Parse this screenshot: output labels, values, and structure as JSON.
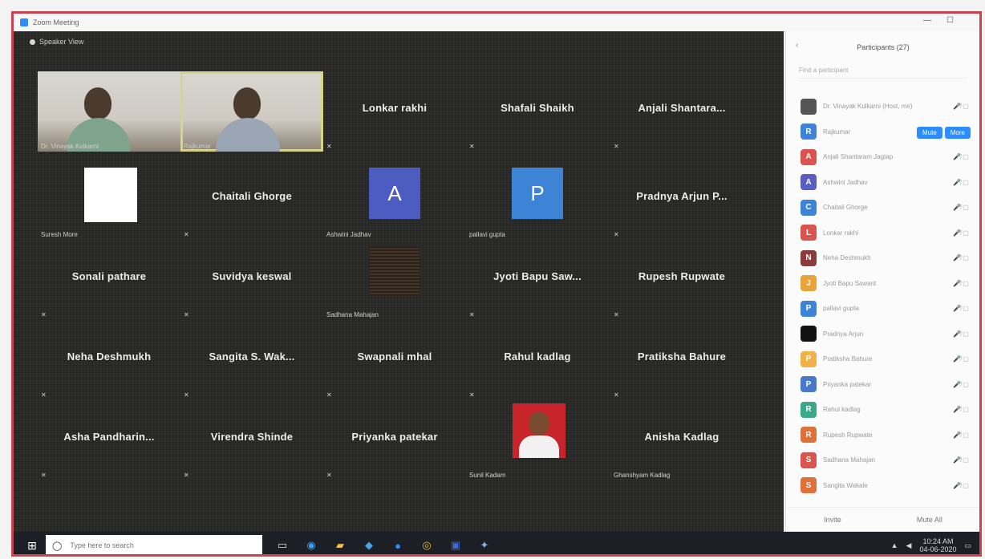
{
  "window": {
    "title": "Zoom Meeting",
    "minimize": "—",
    "maximize": "☐"
  },
  "gallery": {
    "view_label": "Speaker View",
    "tiles": [
      {
        "name": "",
        "caption": "Dr. Vinayak Kulkarni",
        "kind": "video"
      },
      {
        "name": "",
        "caption": "Rajkumar",
        "kind": "video-active"
      },
      {
        "name": "Lonkar rakhi",
        "caption": "",
        "kind": "name"
      },
      {
        "name": "Shafali Shaikh",
        "caption": "",
        "kind": "name"
      },
      {
        "name": "Anjali Shantara...",
        "caption": "",
        "kind": "name"
      },
      {
        "name": "",
        "caption": "Suresh More",
        "kind": "blank"
      },
      {
        "name": "Chaitali Ghorge",
        "caption": "",
        "kind": "name"
      },
      {
        "name": "",
        "caption": "Ashwini Jadhav",
        "kind": "avatar",
        "letter": "A",
        "color": "#4d5cc0"
      },
      {
        "name": "",
        "caption": "pallavi gupta",
        "kind": "avatar",
        "letter": "P",
        "color": "#3e84d6"
      },
      {
        "name": "Pradnya Arjun P...",
        "caption": "",
        "kind": "name"
      },
      {
        "name": "Sonali pathare",
        "caption": "",
        "kind": "name"
      },
      {
        "name": "Suvidya keswal",
        "caption": "",
        "kind": "name"
      },
      {
        "name": "",
        "caption": "Sadhana Mahajan",
        "kind": "dark"
      },
      {
        "name": "Jyoti Bapu Saw...",
        "caption": "",
        "kind": "name"
      },
      {
        "name": "Rupesh Rupwate",
        "caption": "",
        "kind": "name"
      },
      {
        "name": "Neha Deshmukh",
        "caption": "",
        "kind": "name"
      },
      {
        "name": "Sangita S. Wak...",
        "caption": "",
        "kind": "name"
      },
      {
        "name": "Swapnali mhal",
        "caption": "",
        "kind": "name"
      },
      {
        "name": "Rahul kadlag",
        "caption": "",
        "kind": "name"
      },
      {
        "name": "Pratiksha Bahure",
        "caption": "",
        "kind": "name"
      },
      {
        "name": "Asha Pandharin...",
        "caption": "",
        "kind": "name"
      },
      {
        "name": "Virendra Shinde",
        "caption": "",
        "kind": "name"
      },
      {
        "name": "Priyanka patekar",
        "caption": "",
        "kind": "name"
      },
      {
        "name": "",
        "caption": "Sunil Kadam",
        "kind": "photo"
      },
      {
        "name": "Anisha Kadlag",
        "caption": "Ghanshyam Kadlag",
        "kind": "name"
      }
    ]
  },
  "panel": {
    "title": "Participants (27)",
    "search_placeholder": "Find a participant",
    "rows": [
      {
        "text": "Dr. Vinayak Kulkarni (Host, me)",
        "color": "#555555",
        "letter": "",
        "buttons": []
      },
      {
        "text": "Rajkumar",
        "color": "#3e84d6",
        "letter": "R",
        "buttons": [
          "Mute",
          "More"
        ]
      },
      {
        "text": "Anjali Shantaram Jagtap",
        "color": "#d9534f",
        "letter": "A",
        "buttons": []
      },
      {
        "text": "Ashwini Jadhav",
        "color": "#5a5ec0",
        "letter": "A",
        "buttons": []
      },
      {
        "text": "Chaitali Ghorge",
        "color": "#3e84d6",
        "letter": "C",
        "buttons": []
      },
      {
        "text": "Lonkar rakhi",
        "color": "#d9534f",
        "letter": "L",
        "buttons": []
      },
      {
        "text": "Neha Deshmukh",
        "color": "#8a3b3b",
        "letter": "N",
        "buttons": []
      },
      {
        "text": "Jyoti Bapu Sawant",
        "color": "#e8a33d",
        "letter": "J",
        "buttons": []
      },
      {
        "text": "pallavi gupta",
        "color": "#3e84d6",
        "letter": "P",
        "buttons": []
      },
      {
        "text": "Pradnya Arjun",
        "color": "#111111",
        "letter": "",
        "buttons": []
      },
      {
        "text": "Pratiksha Bahure",
        "color": "#f0b04a",
        "letter": "P",
        "buttons": []
      },
      {
        "text": "Priyanka patekar",
        "color": "#4a78c8",
        "letter": "P",
        "buttons": []
      },
      {
        "text": "Rahul kadlag",
        "color": "#3aa88a",
        "letter": "R",
        "buttons": []
      },
      {
        "text": "Rupesh Rupwate",
        "color": "#e0703a",
        "letter": "R",
        "buttons": []
      },
      {
        "text": "Sadhana Mahajan",
        "color": "#d9534f",
        "letter": "S",
        "buttons": []
      },
      {
        "text": "Sangita Wakale",
        "color": "#e0703a",
        "letter": "S",
        "buttons": []
      }
    ],
    "footer": {
      "invite": "Invite",
      "mute_all": "Mute All"
    }
  },
  "taskbar": {
    "search_placeholder": "Type here to search",
    "apps": [
      "task-view",
      "edge",
      "file-explorer",
      "store",
      "zoom",
      "chrome",
      "word",
      "photos"
    ],
    "tray_time": "10:24 AM",
    "tray_date": "04-06-2020"
  }
}
